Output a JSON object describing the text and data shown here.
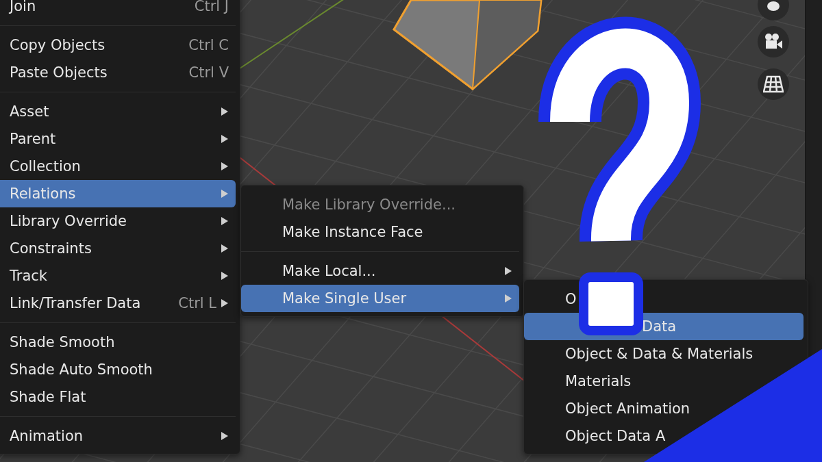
{
  "object_menu": {
    "sections": [
      [
        {
          "label": "Join",
          "shortcut": "Ctrl J",
          "submenu": false,
          "selected": false
        }
      ],
      [
        {
          "label": "Copy Objects",
          "shortcut": "Ctrl C",
          "submenu": false,
          "selected": false
        },
        {
          "label": "Paste Objects",
          "shortcut": "Ctrl V",
          "submenu": false,
          "selected": false
        }
      ],
      [
        {
          "label": "Asset",
          "submenu": true,
          "selected": false
        },
        {
          "label": "Parent",
          "submenu": true,
          "selected": false
        },
        {
          "label": "Collection",
          "submenu": true,
          "selected": false
        },
        {
          "label": "Relations",
          "submenu": true,
          "selected": true
        },
        {
          "label": "Library Override",
          "submenu": true,
          "selected": false
        },
        {
          "label": "Constraints",
          "submenu": true,
          "selected": false
        },
        {
          "label": "Track",
          "submenu": true,
          "selected": false
        },
        {
          "label": "Link/Transfer Data",
          "shortcut": "Ctrl L",
          "submenu": true,
          "selected": false
        }
      ],
      [
        {
          "label": "Shade Smooth",
          "submenu": false,
          "selected": false
        },
        {
          "label": "Shade Auto Smooth",
          "submenu": false,
          "selected": false
        },
        {
          "label": "Shade Flat",
          "submenu": false,
          "selected": false
        }
      ],
      [
        {
          "label": "Animation",
          "submenu": true,
          "selected": false
        }
      ]
    ]
  },
  "relations_menu": {
    "sections": [
      [
        {
          "label": "Make Library Override...",
          "submenu": false,
          "selected": false,
          "disabled": true
        },
        {
          "label": "Make Instance Face",
          "submenu": false,
          "selected": false,
          "disabled": false
        }
      ],
      [
        {
          "label": "Make Local...",
          "submenu": true,
          "selected": false,
          "disabled": false
        },
        {
          "label": "Make Single User",
          "submenu": true,
          "selected": true,
          "disabled": false
        }
      ]
    ]
  },
  "single_user_menu": {
    "sections": [
      [
        {
          "label": "O",
          "selected": false,
          "covered": false
        },
        {
          "label": "Data",
          "selected": true,
          "covered": true
        },
        {
          "label": "Object & Data & Materials",
          "selected": false,
          "covered": false
        },
        {
          "label": "Materials",
          "selected": false,
          "covered": false
        },
        {
          "label": "Object Animation",
          "selected": false,
          "covered": false
        },
        {
          "label": "Object Data A",
          "selected": false,
          "covered": false
        }
      ]
    ]
  }
}
